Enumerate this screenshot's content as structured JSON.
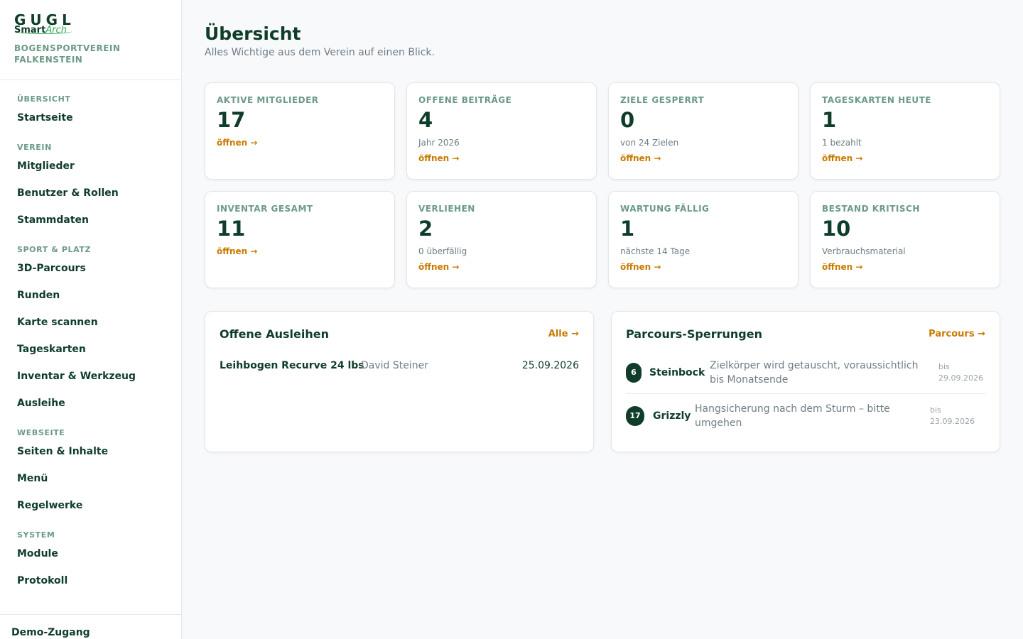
{
  "brand": {
    "logo_top": "GUGL",
    "logo_smart": "Smart",
    "logo_arch": "Arch",
    "club_name": "BOGENSPORTVEREIN FALKENSTEIN"
  },
  "sidebar": {
    "sections": [
      {
        "title": "ÜBERSICHT",
        "items": [
          "Startseite"
        ]
      },
      {
        "title": "VEREIN",
        "items": [
          "Mitglieder",
          "Benutzer & Rollen",
          "Stammdaten"
        ]
      },
      {
        "title": "SPORT & PLATZ",
        "items": [
          "3D-Parcours",
          "Runden",
          "Karte scannen",
          "Tageskarten",
          "Inventar & Werkzeug",
          "Ausleihe"
        ]
      },
      {
        "title": "WEBSEITE",
        "items": [
          "Seiten & Inhalte",
          "Menü",
          "Regelwerke"
        ]
      },
      {
        "title": "SYSTEM",
        "items": [
          "Module",
          "Protokoll"
        ]
      }
    ],
    "footer": "Demo-Zugang"
  },
  "header": {
    "title": "Übersicht",
    "subtitle": "Alles Wichtige aus dem Verein auf einen Blick."
  },
  "stats": [
    {
      "label": "AKTIVE MITGLIEDER",
      "value": "17",
      "sub": "",
      "link": "öffnen →"
    },
    {
      "label": "OFFENE BEITRÄGE",
      "value": "4",
      "sub": "Jahr 2026",
      "link": "öffnen →"
    },
    {
      "label": "ZIELE GESPERRT",
      "value": "0",
      "sub": "von 24 Zielen",
      "link": "öffnen →"
    },
    {
      "label": "TAGESKARTEN HEUTE",
      "value": "1",
      "sub": "1 bezahlt",
      "link": "öffnen →"
    },
    {
      "label": "INVENTAR GESAMT",
      "value": "11",
      "sub": "",
      "link": "öffnen →"
    },
    {
      "label": "VERLIEHEN",
      "value": "2",
      "sub": "0 überfällig",
      "link": "öffnen →"
    },
    {
      "label": "WARTUNG FÄLLIG",
      "value": "1",
      "sub": "nächste 14 Tage",
      "link": "öffnen →"
    },
    {
      "label": "BESTAND KRITISCH",
      "value": "10",
      "sub": "Verbrauchsmaterial",
      "link": "öffnen →"
    }
  ],
  "loans": {
    "title": "Offene Ausleihen",
    "link": "Alle →",
    "rows": [
      {
        "item": "Leihbogen Recurve 24 lbs",
        "person": "David Steiner",
        "date": "25.09.2026"
      }
    ]
  },
  "closures": {
    "title": "Parcours-Sperrungen",
    "link": "Parcours →",
    "rows": [
      {
        "number": "6",
        "name": "Steinbock",
        "reason": "Zielkörper wird getauscht, voraussichtlich bis Monatsende",
        "until_label": "bis",
        "until_date": "29.09.2026"
      },
      {
        "number": "17",
        "name": "Grizzly",
        "reason": "Hangsicherung nach dem Sturm – bitte umgehen",
        "until_label": "bis",
        "until_date": "23.09.2026"
      }
    ]
  },
  "colors": {
    "primary": "#0f3d2a",
    "accent": "#c97a00",
    "brand_green": "#2fa84f",
    "muted": "#6b9a86"
  }
}
